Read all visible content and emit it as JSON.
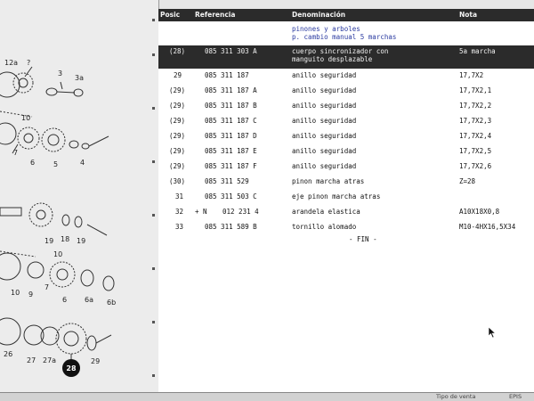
{
  "diagram": {
    "callouts": [
      "12a",
      "?",
      "3",
      "3a",
      "10",
      "7",
      "6",
      "5",
      "4",
      "18",
      "19",
      "19",
      "10",
      "10",
      "9",
      "7",
      "6",
      "6a",
      "6b",
      "26",
      "27",
      "27a",
      "28",
      "29"
    ],
    "selected_callout": "28"
  },
  "table": {
    "headers": {
      "posic": "Posic",
      "referencia": "Referencia",
      "denominacion": "Denominación",
      "nota": "Nota"
    },
    "group_title": [
      "pinones y arboles",
      "p. cambio manual 5 marchas"
    ],
    "rows": [
      {
        "posic": "(28)",
        "prefix": "",
        "ref": "085 311 303 A",
        "den": "cuerpo sincronizador con manguito desplazable",
        "nota": "5a marcha",
        "selected": true
      },
      {
        "posic": "29",
        "prefix": "",
        "ref": "085 311 187",
        "den": "anillo seguridad",
        "nota": "17,7X2"
      },
      {
        "posic": "(29)",
        "prefix": "",
        "ref": "085 311 187 A",
        "den": "anillo seguridad",
        "nota": "17,7X2,1"
      },
      {
        "posic": "(29)",
        "prefix": "",
        "ref": "085 311 187 B",
        "den": "anillo seguridad",
        "nota": "17,7X2,2"
      },
      {
        "posic": "(29)",
        "prefix": "",
        "ref": "085 311 187 C",
        "den": "anillo seguridad",
        "nota": "17,7X2,3"
      },
      {
        "posic": "(29)",
        "prefix": "",
        "ref": "085 311 187 D",
        "den": "anillo seguridad",
        "nota": "17,7X2,4"
      },
      {
        "posic": "(29)",
        "prefix": "",
        "ref": "085 311 187 E",
        "den": "anillo seguridad",
        "nota": "17,7X2,5"
      },
      {
        "posic": "(29)",
        "prefix": "",
        "ref": "085 311 187 F",
        "den": "anillo seguridad",
        "nota": "17,7X2,6"
      },
      {
        "posic": "(30)",
        "prefix": "",
        "ref": "085 311 529",
        "den": "pinon marcha atras",
        "nota": "Z=28"
      },
      {
        "posic": "31",
        "prefix": "",
        "ref": "085 311 503 C",
        "den": "eje pinon marcha atras",
        "nota": ""
      },
      {
        "posic": "32",
        "prefix": "+ N",
        "ref": "012 231 4",
        "den": "arandela elastica",
        "nota": "A10X18X0,8"
      },
      {
        "posic": "33",
        "prefix": "",
        "ref": "085 311 589 B",
        "den": "tornillo alomado",
        "nota": "M10-4HX16,5X34"
      }
    ],
    "end_label": "- FIN -"
  },
  "statusbar": {
    "left": "",
    "right": "Tipo de venta",
    "far_right": "EPIS"
  },
  "colors": {
    "header_bg": "#2b2b2b",
    "selected_row_bg": "#2b2b2b",
    "group_text": "#2a3aa0"
  }
}
